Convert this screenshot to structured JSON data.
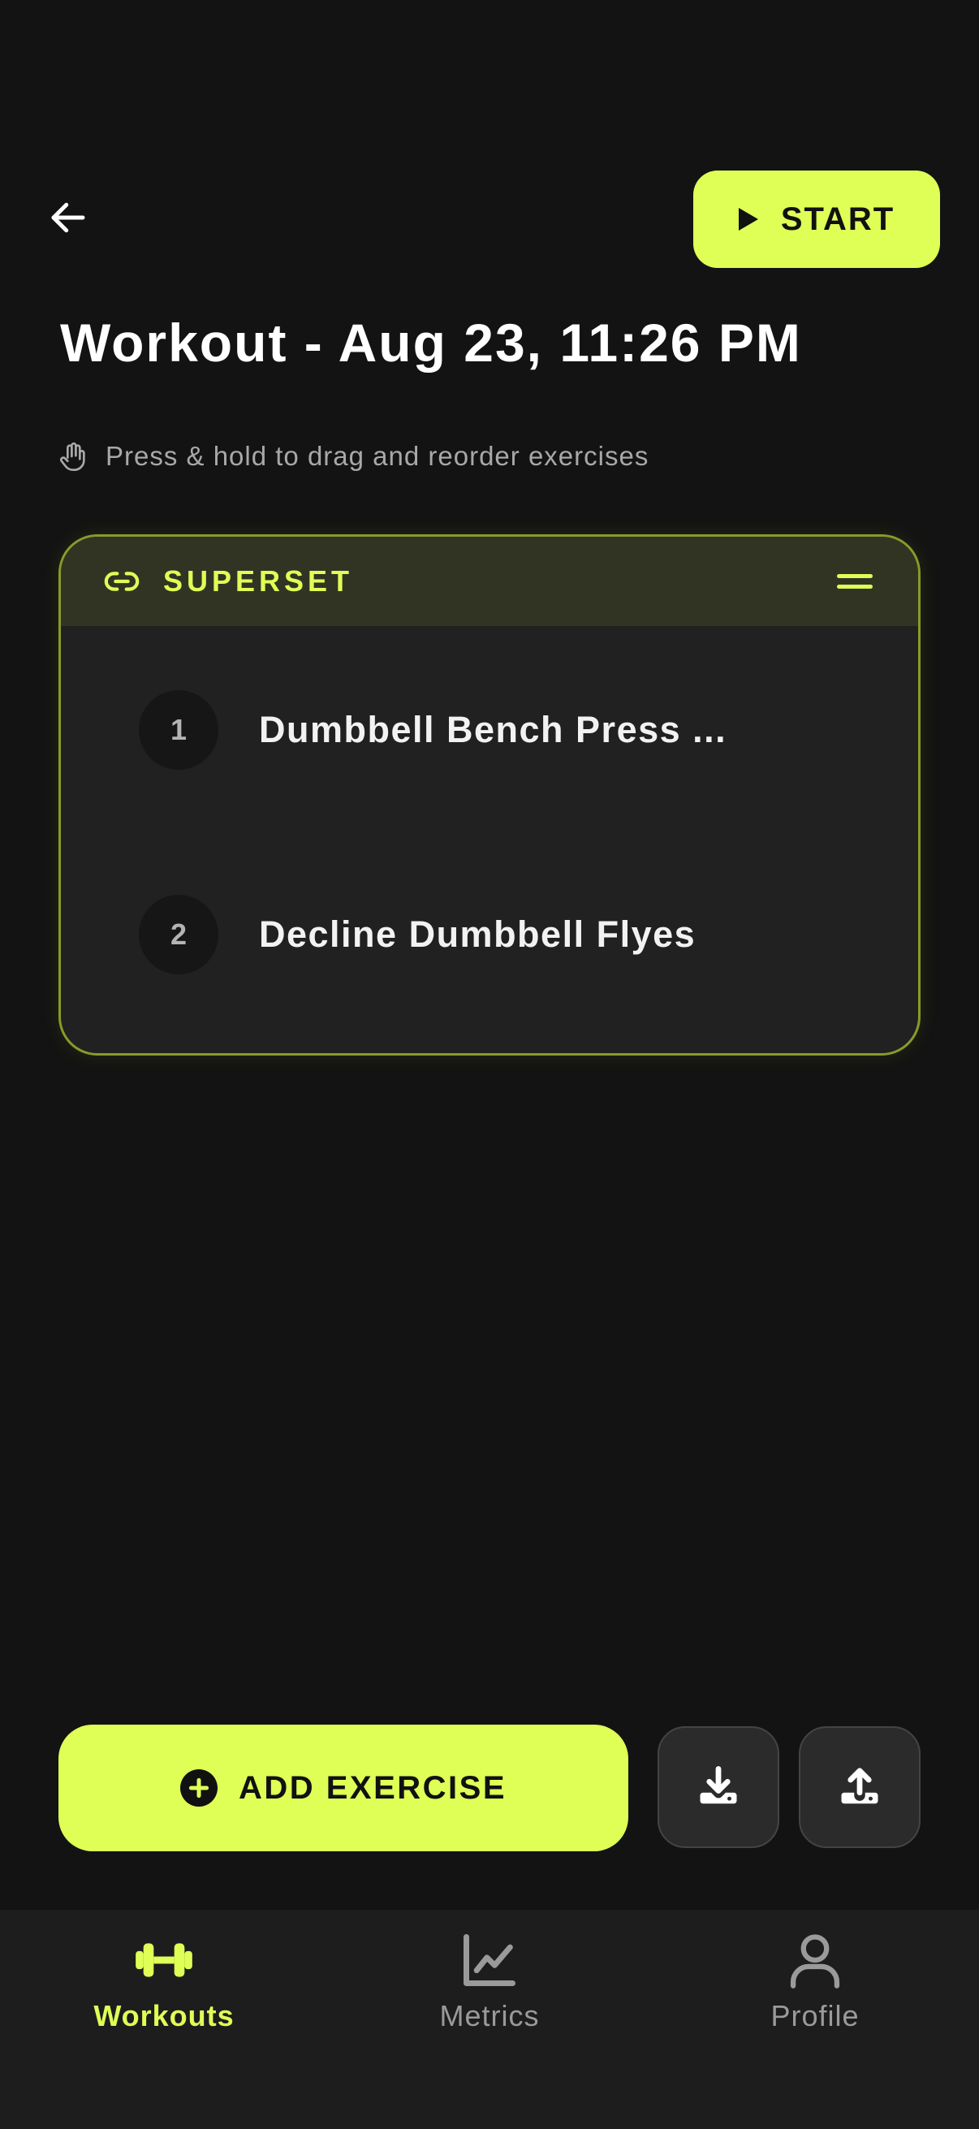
{
  "header": {
    "back_icon": "arrow-left-icon",
    "start_label": "START",
    "start_icon": "play-icon",
    "title": "Workout - Aug 23, 11:26 PM",
    "hint_icon": "hand-icon",
    "hint": "Press & hold to drag and reorder exercises"
  },
  "superset": {
    "label": "SUPERSET",
    "link_icon": "link-icon",
    "drag_icon": "drag-handle-icon",
    "exercises": [
      {
        "number": "1",
        "name": "Dumbbell Bench Press ..."
      },
      {
        "number": "2",
        "name": "Decline Dumbbell Flyes"
      }
    ]
  },
  "actions": {
    "add_exercise_label": "ADD EXERCISE",
    "add_icon": "plus-circle-icon",
    "import_icon": "download-icon",
    "export_icon": "upload-icon"
  },
  "tabs": [
    {
      "label": "Workouts",
      "icon": "dumbbell-icon",
      "active": true
    },
    {
      "label": "Metrics",
      "icon": "chart-icon",
      "active": false
    },
    {
      "label": "Profile",
      "icon": "person-icon",
      "active": false
    }
  ],
  "colors": {
    "accent": "#dfff57",
    "background": "#131313",
    "card": "#212121",
    "superset_border": "#8a9a2a",
    "muted_text": "#a8a8a8"
  }
}
